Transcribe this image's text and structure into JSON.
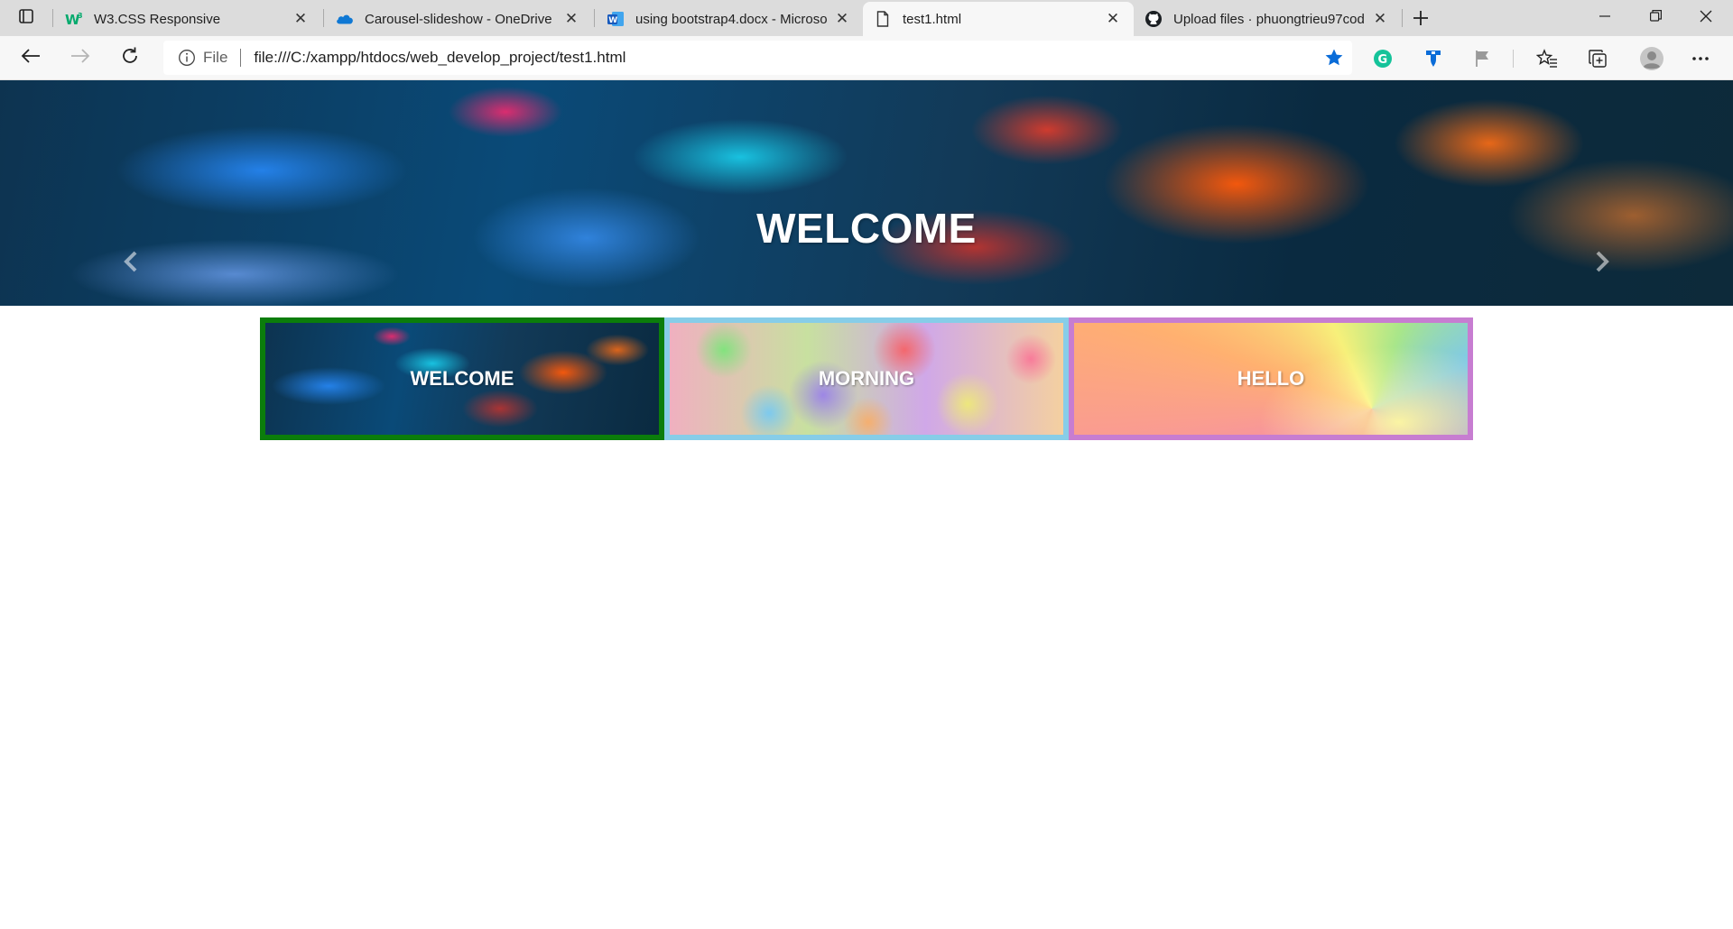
{
  "browser": {
    "tabs": [
      {
        "title": "W3.CSS Responsive",
        "favicon": "w3schools-icon",
        "active": false
      },
      {
        "title": "Carousel-slideshow - OneDrive",
        "favicon": "onedrive-icon",
        "active": false
      },
      {
        "title": "using bootstrap4.docx - Microso",
        "favicon": "word-icon",
        "active": false
      },
      {
        "title": "test1.html",
        "favicon": "document-icon",
        "active": true
      },
      {
        "title": "Upload files · phuongtrieu97cod",
        "favicon": "github-icon",
        "active": false
      }
    ],
    "address": {
      "scheme_label": "File",
      "url": "file:///C:/xampp/htdocs/web_develop_project/test1.html"
    },
    "accent_color": "#0a6cd8"
  },
  "page": {
    "hero": {
      "title": "WELCOME"
    },
    "thumbnails": [
      {
        "label": "WELCOME",
        "border_color": "#0b7d0b"
      },
      {
        "label": "MORNING",
        "border_color": "#87cde8"
      },
      {
        "label": "HELLO",
        "border_color": "#c77dd1"
      }
    ]
  }
}
